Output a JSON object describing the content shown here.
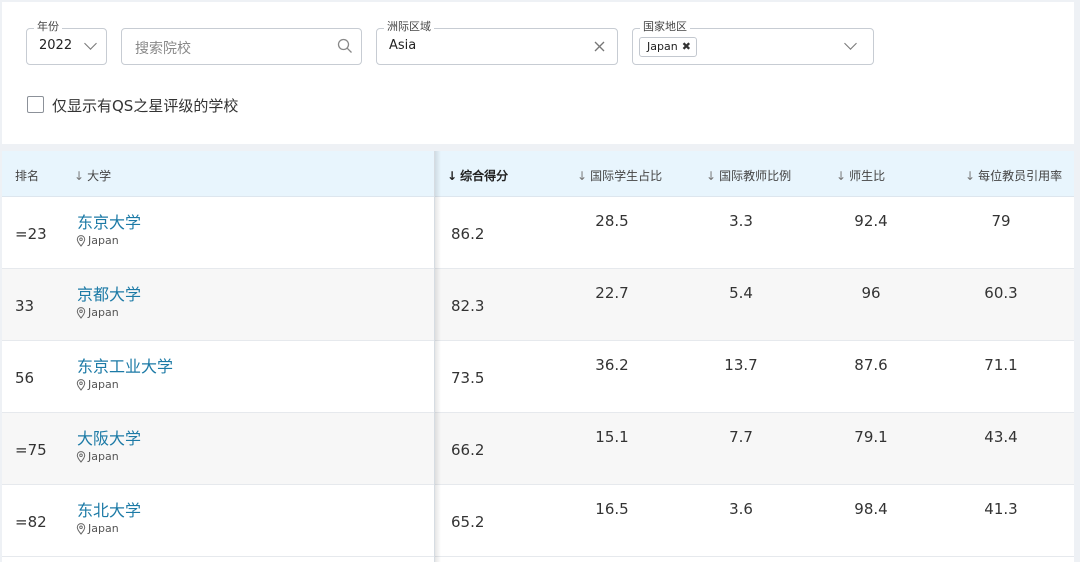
{
  "filters": {
    "year": {
      "label": "年份",
      "value": "2022"
    },
    "search": {
      "placeholder": "搜索院校"
    },
    "region": {
      "label": "洲际区域",
      "value": "Asia"
    },
    "country": {
      "label": "国家地区",
      "chip": "Japan"
    },
    "qs_stars_only": {
      "label": "仅显示有QS之星评级的学校",
      "checked": false
    }
  },
  "table": {
    "headers": {
      "rank": "排名",
      "university": "大学",
      "overall": "综合得分",
      "intl_students": "国际学生占比",
      "intl_faculty": "国际教师比例",
      "faculty_student": "师生比",
      "citations": "每位教员引用率"
    },
    "rows": [
      {
        "rank": "=23",
        "name": "东京大学",
        "location": "Japan",
        "overall": "86.2",
        "intl_students": "28.5",
        "intl_faculty": "3.3",
        "faculty_student": "92.4",
        "citations": "79"
      },
      {
        "rank": "33",
        "name": "京都大学",
        "location": "Japan",
        "overall": "82.3",
        "intl_students": "22.7",
        "intl_faculty": "5.4",
        "faculty_student": "96",
        "citations": "60.3"
      },
      {
        "rank": "56",
        "name": "东京工业大学",
        "location": "Japan",
        "overall": "73.5",
        "intl_students": "36.2",
        "intl_faculty": "13.7",
        "faculty_student": "87.6",
        "citations": "71.1"
      },
      {
        "rank": "=75",
        "name": "大阪大学",
        "location": "Japan",
        "overall": "66.2",
        "intl_students": "15.1",
        "intl_faculty": "7.7",
        "faculty_student": "79.1",
        "citations": "43.4"
      },
      {
        "rank": "=82",
        "name": "东北大学",
        "location": "Japan",
        "overall": "65.2",
        "intl_students": "16.5",
        "intl_faculty": "3.6",
        "faculty_student": "98.4",
        "citations": "41.3"
      }
    ]
  },
  "colors": {
    "accent": "#1c7aa6",
    "header_bg": "#e8f5fd"
  },
  "icons": {
    "search": "search-icon",
    "clear": "clear-icon",
    "dropdown": "chevron-down-icon",
    "location": "location-pin-icon",
    "sort": "sort-arrow-down-icon"
  }
}
